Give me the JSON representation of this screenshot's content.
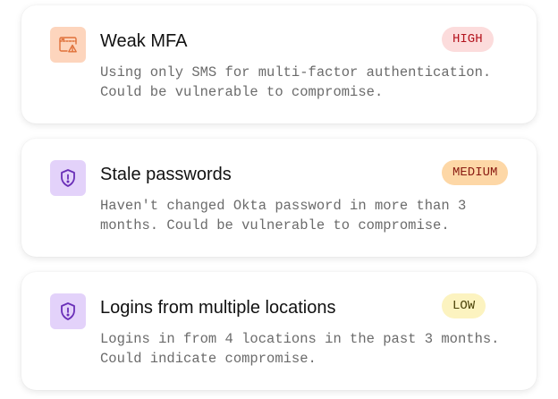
{
  "risks": [
    {
      "title": "Weak MFA",
      "severity": "HIGH",
      "description": "Using only SMS for multi-factor authentication. Could be vulnerable to compromise.",
      "icon": "browser-warning-icon",
      "icon_color": "#e0713a",
      "icon_bg": "#fdd5bd",
      "badge_bg": "#fcdcdc",
      "badge_fg": "#b4141e"
    },
    {
      "title": "Stale passwords",
      "severity": "MEDIUM",
      "description": "Haven't changed Okta password in more than 3 months. Could be vulnerable to compromise.",
      "icon": "shield-alert-icon",
      "icon_color": "#6a2fb8",
      "icon_bg": "#e3d2fa",
      "badge_bg": "#fdd7a6",
      "badge_fg": "#8a1c12"
    },
    {
      "title": "Logins from multiple locations",
      "severity": "LOW",
      "description": "Logins in from 4 locations in the past 3 months. Could indicate compromise.",
      "icon": "shield-alert-icon",
      "icon_color": "#6a2fb8",
      "icon_bg": "#e3d2fa",
      "badge_bg": "#fcf3c0",
      "badge_fg": "#4a4208"
    }
  ]
}
